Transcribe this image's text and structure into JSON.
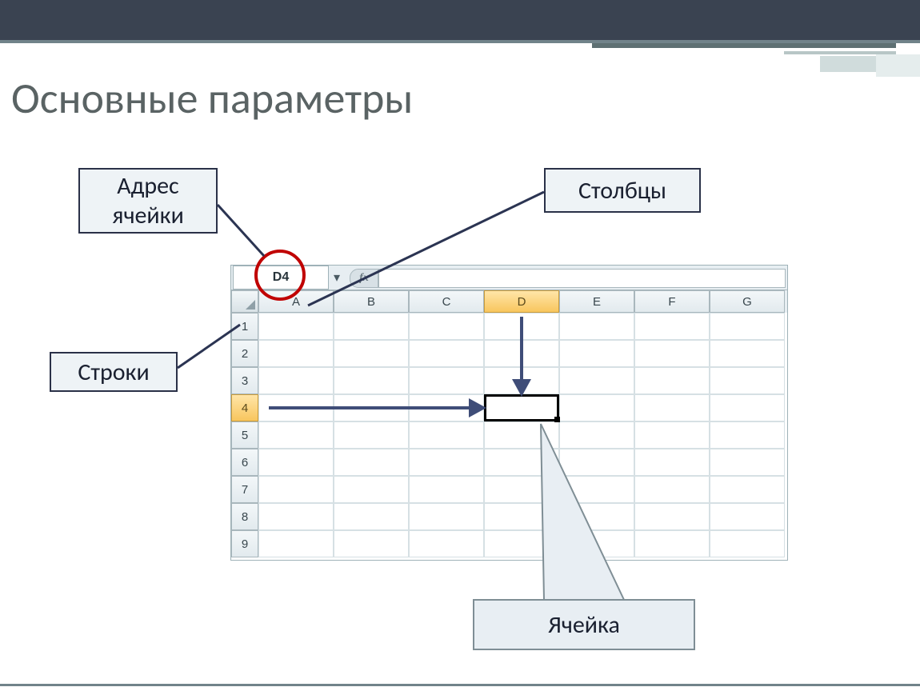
{
  "slide": {
    "title": "Основные параметры"
  },
  "labels": {
    "address": "Адрес ячейки",
    "columns": "Столбцы",
    "rows": "Строки",
    "cell": "Ячейка"
  },
  "spreadsheet": {
    "name_box": "D4",
    "fx_symbol": "fx",
    "columns": [
      "A",
      "B",
      "C",
      "D",
      "E",
      "F",
      "G"
    ],
    "rows": [
      "1",
      "2",
      "3",
      "4",
      "5",
      "6",
      "7",
      "8",
      "9"
    ],
    "active_column": "D",
    "active_row": "4"
  },
  "colors": {
    "accent": "#3f4d78",
    "highlight": "#f8c65e",
    "circle": "#c00000"
  }
}
